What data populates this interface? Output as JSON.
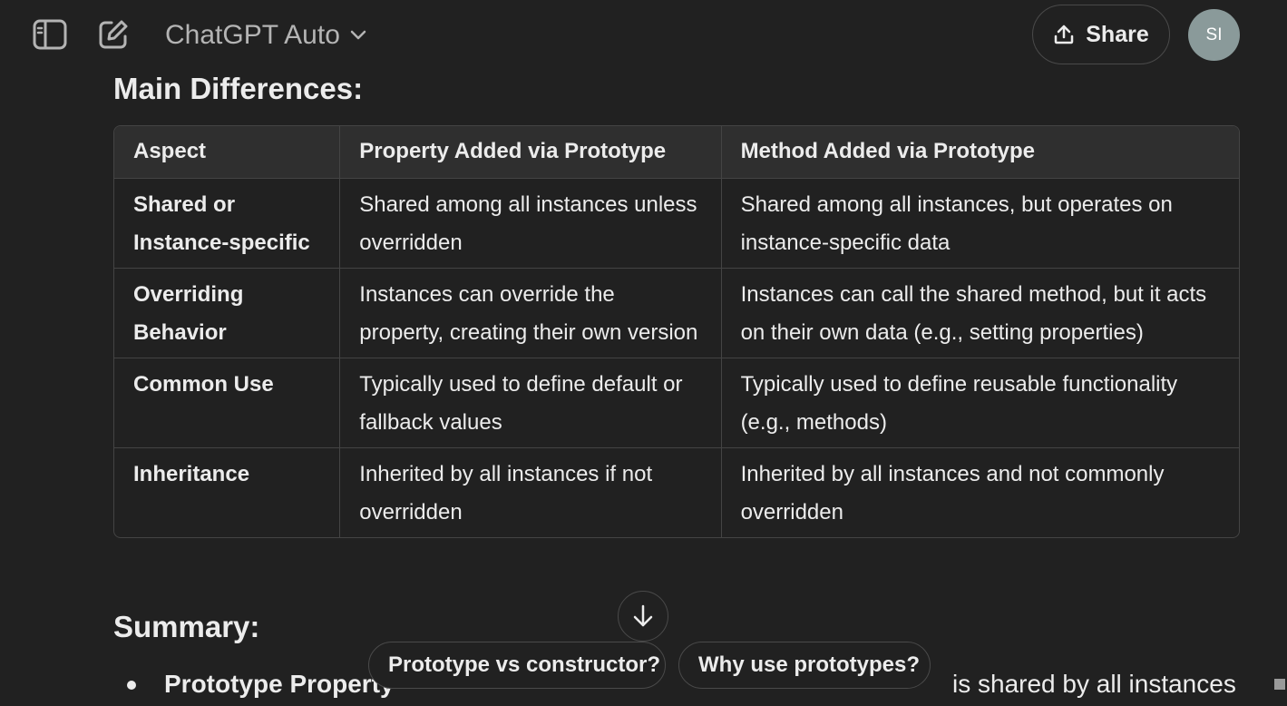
{
  "header": {
    "sidebar_toggle_icon": "sidebar-toggle-icon",
    "new_chat_icon": "edit-icon",
    "model_name": "ChatGPT Auto",
    "share_label": "Share",
    "avatar_initials": "SI"
  },
  "content": {
    "main_heading": "Main Differences:",
    "table": {
      "headers": [
        "Aspect",
        "Property Added via Prototype",
        "Method Added via Prototype"
      ],
      "rows": [
        [
          "Shared or Instance-specific",
          "Shared among all instances unless overridden",
          "Shared among all instances, but operates on instance-specific data"
        ],
        [
          "Overriding Behavior",
          "Instances can override the property, creating their own version",
          "Instances can call the shared method, but it acts on their own data (e.g., setting properties)"
        ],
        [
          "Common Use",
          "Typically used to define default or fallback values",
          "Typically used to define reusable functionality (e.g., methods)"
        ],
        [
          "Inheritance",
          "Inherited by all instances if not overridden",
          "Inherited by all instances and not commonly overridden"
        ]
      ]
    },
    "summary_heading": "Summary:",
    "bullet_bold": "Prototype Property",
    "bullet_rest": "is shared by all instances"
  },
  "suggestions": [
    "Prototype vs constructor?",
    "Why use prototypes?"
  ],
  "colors": {
    "background": "#212121",
    "header_cell": "#2f2f2f",
    "border": "#444444",
    "text": "#ececec",
    "avatar": "#8a9a9a"
  }
}
